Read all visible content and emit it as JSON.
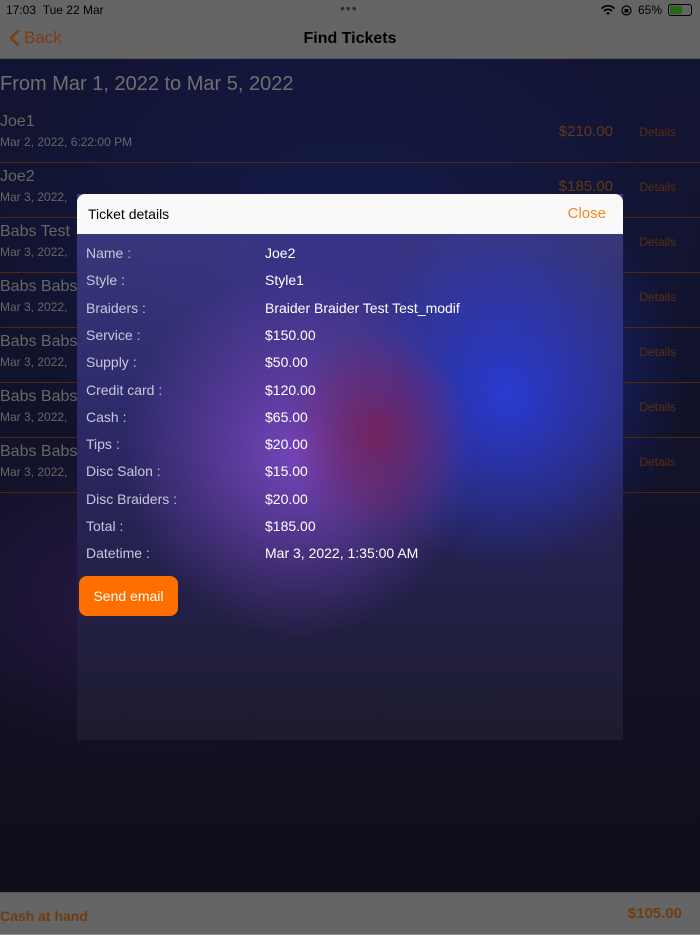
{
  "status": {
    "time": "17:03",
    "date": "Tue 22 Mar",
    "battery": "65%",
    "battery_level": 0.65
  },
  "nav": {
    "back": "Back",
    "title": "Find Tickets"
  },
  "range": "From Mar 1, 2022 to Mar 5, 2022",
  "tickets": [
    {
      "name": "Joe1",
      "date": "Mar 2, 2022, 6:22:00 PM",
      "amount": "$210.00",
      "details": "Details"
    },
    {
      "name": "Joe2",
      "date": "Mar 3, 2022,",
      "amount": "$185.00",
      "details": "Details"
    },
    {
      "name": "Babs Test",
      "date": "Mar 3, 2022,",
      "amount": "",
      "details": "Details"
    },
    {
      "name": "Babs Babs",
      "date": "Mar 3, 2022,",
      "amount": "",
      "details": "Details"
    },
    {
      "name": "Babs Babs",
      "date": "Mar 3, 2022,",
      "amount": "",
      "details": "Details"
    },
    {
      "name": "Babs Babs",
      "date": "Mar 3, 2022,",
      "amount": "",
      "details": "Details"
    },
    {
      "name": "Babs Babs",
      "date": "Mar 3, 2022,",
      "amount": "",
      "details": "Details"
    }
  ],
  "modal": {
    "title": "Ticket details",
    "close": "Close",
    "fields": [
      {
        "label": "Name :",
        "value": "Joe2"
      },
      {
        "label": "Style :",
        "value": "Style1"
      },
      {
        "label": "Braiders :",
        "value": "Braider Braider  Test Test_modif"
      },
      {
        "label": "Service :",
        "value": "$150.00"
      },
      {
        "label": "Supply :",
        "value": "$50.00"
      },
      {
        "label": "Credit card :",
        "value": "$120.00"
      },
      {
        "label": "Cash :",
        "value": "$65.00"
      },
      {
        "label": "Tips :",
        "value": "$20.00"
      },
      {
        "label": "Disc Salon :",
        "value": "$15.00"
      },
      {
        "label": "Disc Braiders :",
        "value": "$20.00"
      },
      {
        "label": "Total :",
        "value": "$185.00"
      },
      {
        "label": "Datetime :",
        "value": "Mar 3, 2022, 1:35:00 AM"
      }
    ],
    "send": "Send email"
  },
  "footer": {
    "label": "Cash at hand",
    "value": "$105.00"
  }
}
